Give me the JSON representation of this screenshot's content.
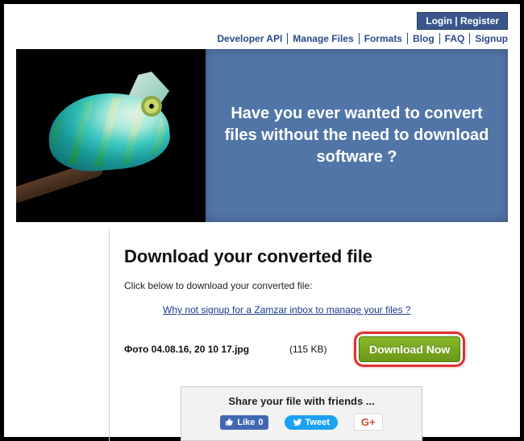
{
  "auth": {
    "login": "Login",
    "register": "Register"
  },
  "nav": [
    "Developer API",
    "Manage Files",
    "Formats",
    "Blog",
    "FAQ",
    "Signup"
  ],
  "hero": {
    "headline": "Have you ever wanted to convert files without the need to download software ?"
  },
  "main": {
    "title": "Download your converted file",
    "subtitle": "Click below to download your converted file:",
    "signup_link": "Why not signup for a Zamzar inbox to manage your files ?"
  },
  "file": {
    "name": "Фото 04.08.16, 20 10 17.jpg",
    "size": "(115 KB)",
    "download_label": "Download Now"
  },
  "share": {
    "title": "Share your file with friends ...",
    "fb": {
      "label": "Like",
      "count": "0"
    },
    "tw": {
      "label": "Tweet"
    },
    "gp": {
      "label": "G+"
    }
  }
}
